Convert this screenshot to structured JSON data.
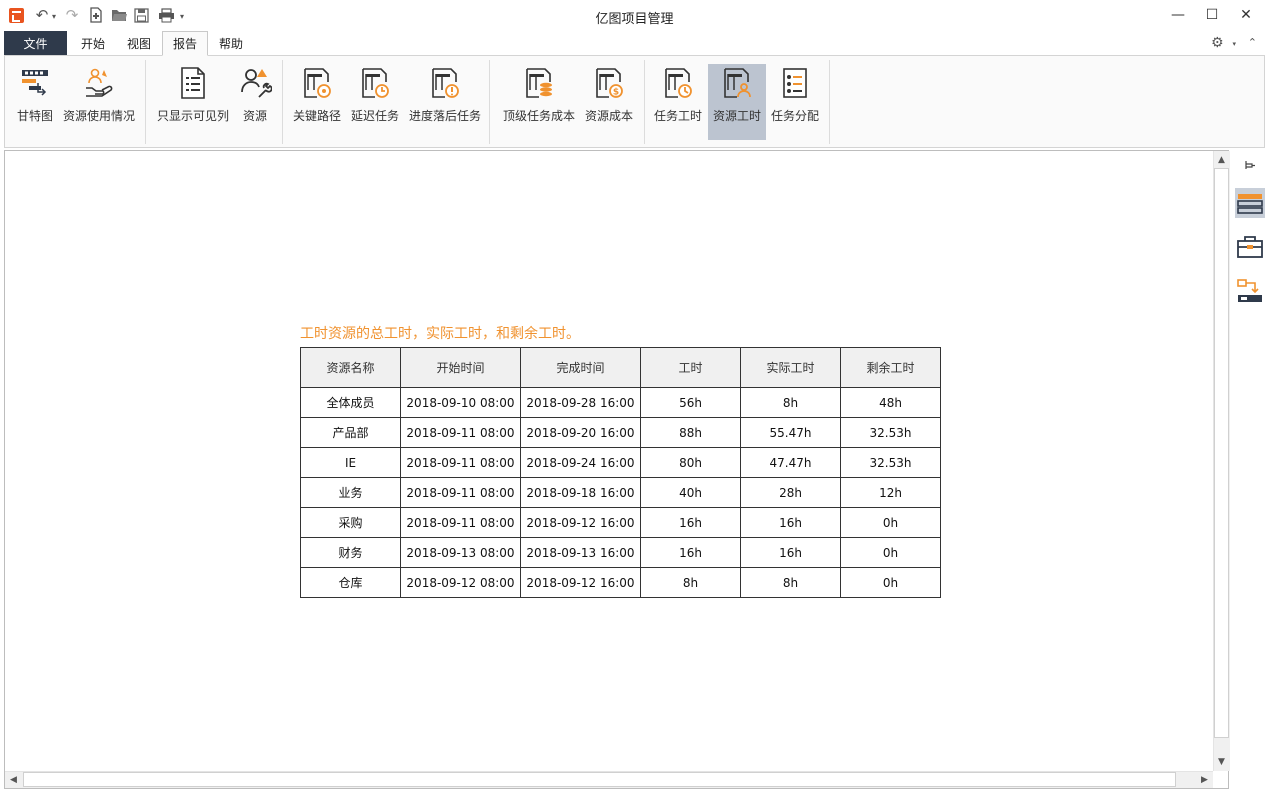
{
  "window": {
    "title": "亿图项目管理",
    "minimize": "—",
    "maximize": "☐",
    "close": "✕"
  },
  "menu": {
    "file": "文件",
    "tabs": [
      {
        "label": "开始"
      },
      {
        "label": "视图"
      },
      {
        "label": "报告"
      },
      {
        "label": "帮助"
      }
    ],
    "active_tab": "报告"
  },
  "ribbon": {
    "buttons": [
      {
        "label": "甘特图",
        "icon": "gantt-chart-icon"
      },
      {
        "label": "资源使用情况",
        "icon": "resource-usage-icon"
      },
      {
        "label": "只显示可见列",
        "icon": "visible-columns-icon"
      },
      {
        "label": "资源",
        "icon": "resource-icon"
      },
      {
        "label": "关键路径",
        "icon": "critical-path-icon"
      },
      {
        "label": "延迟任务",
        "icon": "delayed-task-icon"
      },
      {
        "label": "进度落后任务",
        "icon": "behind-schedule-icon"
      },
      {
        "label": "顶级任务成本",
        "icon": "top-task-cost-icon"
      },
      {
        "label": "资源成本",
        "icon": "resource-cost-icon"
      },
      {
        "label": "任务工时",
        "icon": "task-work-icon"
      },
      {
        "label": "资源工时",
        "icon": "resource-work-icon"
      },
      {
        "label": "任务分配",
        "icon": "task-assignment-icon"
      }
    ],
    "selected": "资源工时"
  },
  "report": {
    "title": "工时资源的总工时，实际工时，和剩余工时。",
    "columns": [
      "资源名称",
      "开始时间",
      "完成时间",
      "工时",
      "实际工时",
      "剩余工时"
    ],
    "rows": [
      [
        "全体成员",
        "2018-09-10 08:00",
        "2018-09-28 16:00",
        "56h",
        "8h",
        "48h"
      ],
      [
        "产品部",
        "2018-09-11 08:00",
        "2018-09-20 16:00",
        "88h",
        "55.47h",
        "32.53h"
      ],
      [
        "IE",
        "2018-09-11 08:00",
        "2018-09-24 16:00",
        "80h",
        "47.47h",
        "32.53h"
      ],
      [
        "业务",
        "2018-09-11 08:00",
        "2018-09-18 16:00",
        "40h",
        "28h",
        "12h"
      ],
      [
        "采购",
        "2018-09-11 08:00",
        "2018-09-12 16:00",
        "16h",
        "16h",
        "0h"
      ],
      [
        "财务",
        "2018-09-13 08:00",
        "2018-09-13 16:00",
        "16h",
        "16h",
        "0h"
      ],
      [
        "仓库",
        "2018-09-12 08:00",
        "2018-09-12 16:00",
        "8h",
        "8h",
        "0h"
      ]
    ]
  },
  "colors": {
    "accent": "#f0922f",
    "file_tab": "#2f3a4b",
    "selected_button": "#bcc4d0"
  }
}
